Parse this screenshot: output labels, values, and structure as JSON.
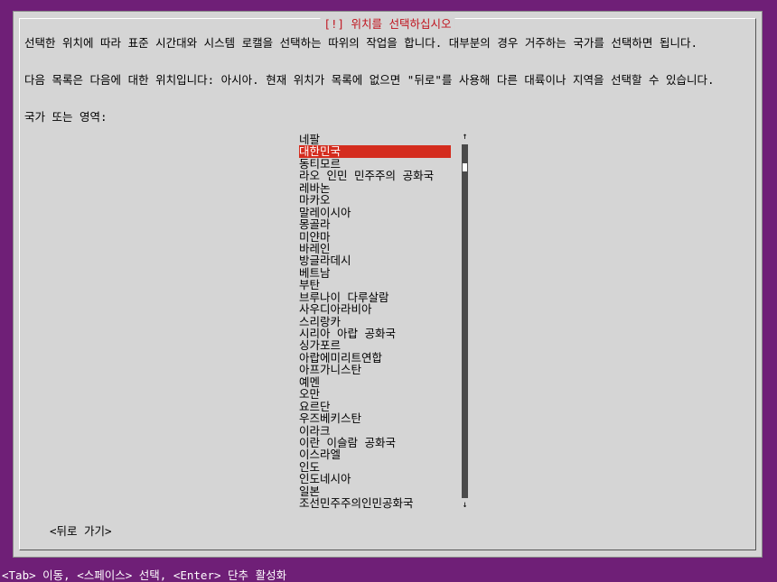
{
  "dialog": {
    "title": "[!] 위치를 선택하십시오",
    "paragraph1": "선택한 위치에 따라 표준 시간대와 시스템 로캘을 선택하는 따위의 작업을 합니다. 대부분의 경우 거주하는 국가를 선택하면 됩니다.",
    "paragraph2": "다음 목록은 다음에 대한 위치입니다: 아시아. 현재 위치가 목록에 없으면 \"뒤로\"를 사용해 다른 대륙이나 지역을 선택할 수 있습니다.",
    "prompt": "국가 또는 영역:",
    "back_button": "<뒤로 가기>"
  },
  "countries": [
    "네팔",
    "대한민국",
    "동티모르",
    "라오 인민 민주주의 공화국",
    "레바논",
    "마카오",
    "말레이시아",
    "몽골라",
    "미얀마",
    "바레인",
    "방글라데시",
    "베트남",
    "부탄",
    "브루나이 다루살람",
    "사우디아라비아",
    "스리랑카",
    "시리아 아랍 공화국",
    "싱가포르",
    "아랍에미리트연합",
    "아프가니스탄",
    "예멘",
    "오만",
    "요르단",
    "우즈베키스탄",
    "이라크",
    "이란 이슬람 공화국",
    "이스라엘",
    "인도",
    "인도네시아",
    "일본",
    "조선민주주의인민공화국"
  ],
  "selected_country": "대한민국",
  "scroll": {
    "up_arrow": "↑",
    "down_arrow": "↓"
  },
  "statusbar": {
    "text": "<Tab> 이동, <스페이스> 선택, <Enter> 단추 활성화"
  },
  "colors": {
    "background": "#6f1f77",
    "dialog": "#d5d5d5",
    "title": "#c0141e",
    "selection": "#d42c1e"
  }
}
